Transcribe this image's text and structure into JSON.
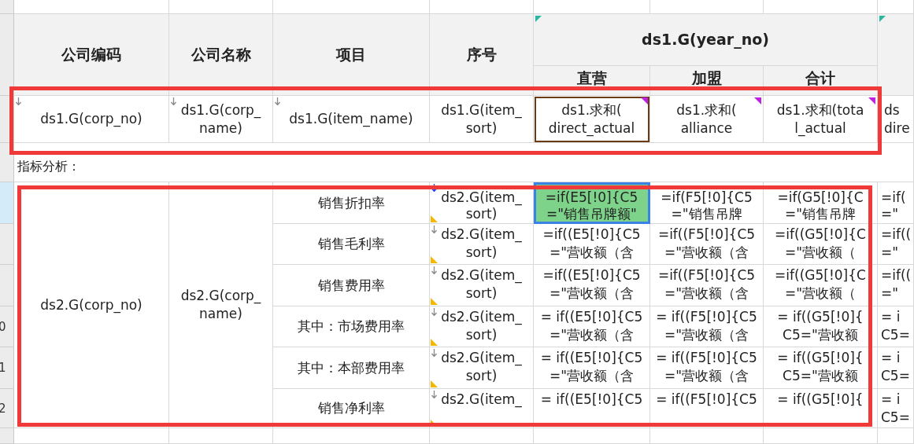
{
  "header": {
    "columns": [
      "公司编码",
      "公司名称",
      "项目",
      "序号"
    ],
    "group": "ds1.G(year_no)",
    "subcolumns": [
      "直营",
      "加盟",
      "合计"
    ]
  },
  "field_row": [
    {
      "text": "ds1.G(corp_no)",
      "outlined": false,
      "kind": "group"
    },
    {
      "text": "ds1.G(corp_\nname)",
      "outlined": false,
      "kind": "group"
    },
    {
      "text": "ds1.G(item_name)",
      "outlined": false,
      "kind": "group"
    },
    {
      "text": "ds1.G(item_\nsort)",
      "outlined": false,
      "kind": "plain"
    },
    {
      "text": "ds1.求和(\ndirect_actual",
      "outlined": true,
      "kind": "sum"
    },
    {
      "text": "ds1.求和(\nalliance",
      "outlined": false,
      "kind": "sum"
    },
    {
      "text": "ds1.求和(tota\nl_actual",
      "outlined": false,
      "kind": "sum"
    },
    {
      "text": "ds\ndire",
      "outlined": false,
      "kind": "plain"
    }
  ],
  "section_label": "指标分析：",
  "body": {
    "corp_no": "ds2.G(corp_no)",
    "corp_name": "ds2.G(corp_\nname)",
    "rows": [
      {
        "item": "销售折扣率",
        "sort": "ds2.G(item_\nsort)",
        "cells": [
          {
            "text": "=if(E5[!0]{C5\n=\"销售吊牌额\"",
            "selected": true
          },
          {
            "text": "=if(F5[!0]{C5\n=\"销售吊牌",
            "selected": false
          },
          {
            "text": "=if(G5[!0]{C\n=\"销售吊牌",
            "selected": false
          },
          {
            "text": "=if(\n=\"",
            "selected": false
          }
        ]
      },
      {
        "item": "销售毛利率",
        "sort": "ds2.G(item_\nsort)",
        "cells": [
          {
            "text": "=if((E5[!0]{C5\n=\"营收额（含",
            "selected": false
          },
          {
            "text": "=if((F5[!0]{C5\n=\"营收额（含",
            "selected": false
          },
          {
            "text": "=if((G5[!0]{C\n=\"营收额（",
            "selected": false
          },
          {
            "text": "=if((\n=\"",
            "selected": false
          }
        ]
      },
      {
        "item": "销售费用率",
        "sort": "ds2.G(item_\nsort)",
        "cells": [
          {
            "text": "=if((E5[!0]{C5\n=\"营收额（含",
            "selected": false
          },
          {
            "text": "=if((F5[!0]{C5\n=\"营收额（含",
            "selected": false
          },
          {
            "text": "=if((G5[!0]{C\n=\"营收额（",
            "selected": false
          },
          {
            "text": "=if((\n=\"",
            "selected": false
          }
        ]
      },
      {
        "item": "其中：市场费用率",
        "row_number": "0",
        "sort": "ds2.G(item_\nsort)",
        "cells": [
          {
            "text": "= if((E5[!0]{C5\n=\"营收额（含",
            "selected": false
          },
          {
            "text": "= if((F5[!0]{C5\n=\"营收额（含",
            "selected": false
          },
          {
            "text": "= if((G5[!0]{\nC5=\"营收额",
            "selected": false
          },
          {
            "text": "= i\nC5=",
            "selected": false
          }
        ]
      },
      {
        "item": "其中：本部费用率",
        "row_number": "1",
        "sort": "ds2.G(item_\nsort)",
        "cells": [
          {
            "text": "= if((E5[!0]{C5\n=\"营收额（含",
            "selected": false
          },
          {
            "text": "= if((F5[!0]{C5\n=\"营收额（含",
            "selected": false
          },
          {
            "text": "= if((G5[!0]{\nC5=\"营收额",
            "selected": false
          },
          {
            "text": "= i\nC5=",
            "selected": false
          }
        ]
      },
      {
        "item": "销售净利率",
        "row_number": "2",
        "sort": "ds2.G(item_",
        "cells": [
          {
            "text": "= if((E5[!0]{C5",
            "selected": false
          },
          {
            "text": "= if((F5[!0]{C5",
            "selected": false
          },
          {
            "text": "= if((G5[!0]{",
            "selected": false
          },
          {
            "text": "= i\nC5=",
            "selected": false
          }
        ]
      }
    ]
  },
  "field_row_highlighted": true,
  "body_highlighted": true
}
